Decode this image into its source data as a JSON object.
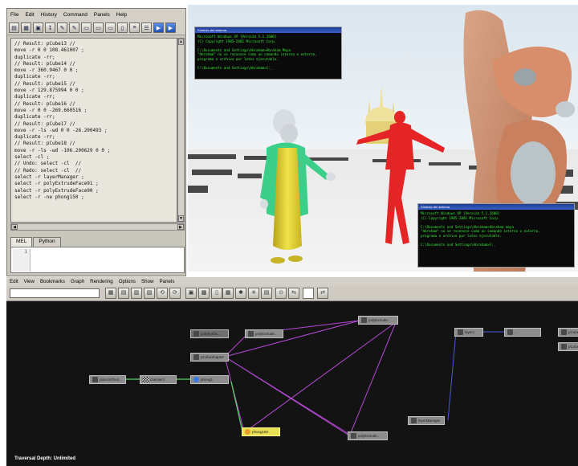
{
  "script_editor": {
    "menu": [
      "File",
      "Edit",
      "History",
      "Command",
      "Panels",
      "Help"
    ],
    "history_lines": [
      "// Result: pCube13 //",
      "move -r 0 0 108.461007 ;",
      "duplicate -rr;",
      "// Result: pCube14 //",
      "move -r 360.9467 0 0 ;",
      "duplicate -rr;",
      "// Result: pCube15 //",
      "move -r 129.875994 0 0 ;",
      "duplicate -rr;",
      "// Result: pCube16 //",
      "move -r 0 0 -269.660516 ;",
      "duplicate -rr;",
      "// Result: pCube17 //",
      "move -r -ls -wd 0 0 -26.200493 ;",
      "duplicate -rr;",
      "// Result: pCube18 //",
      "move -r -ls -wd -106.200629 0 0 ;",
      "select -cl ;",
      "// Undo: select -cl  //",
      "// Redo: select -cl  //",
      "select -r layerManager ;",
      "select -r polyExtrudeFace91 ;",
      "select -r polyExtrudeFace90 ;",
      "select -r -ne phong150 ;"
    ],
    "tabs": [
      "MEL",
      "Python"
    ],
    "line_number": "1"
  },
  "viewport": {
    "terminal_top": {
      "title": "Símbolo del sistema",
      "lines": [
        "Microsoft Windows XP [Versión 5.1.2600]",
        "(C) Copyright 1985-2001 Microsoft Corp.",
        "",
        "C:\\Documents and Settings\\Abraham>Abraham Maya",
        "\"Abraham\" no se reconoce como un comando interno o externo,",
        "programa o archivo por lotes ejecutable.",
        "",
        "C:\\Documents and Settings\\Abraham>C:_"
      ]
    },
    "terminal_bottom": {
      "title": "Símbolo del sistema",
      "lines": [
        "Microsoft Windows XP [Versión 5.1.2600]",
        "(C) Copyright 1985-2001 Microsoft Corp.",
        "",
        "C:\\Documents and Settings\\Abraham>Abraham maya",
        "\"Abraham\" no se reconoce como un comando interno o externo,",
        "programa o archivo por lotes ejecutable.",
        "",
        "C:\\Documents and Settings\\Abraham>C:_"
      ]
    }
  },
  "node_editor": {
    "menu": [
      "Edit",
      "View",
      "Bookmarks",
      "Graph",
      "Rendering",
      "Options",
      "Show",
      "Panels"
    ],
    "nodes": [
      {
        "id": "n_place",
        "label": "place2dText..."
      },
      {
        "id": "n_checker",
        "label": "checker1"
      },
      {
        "id": "n_phong1",
        "label": "phong1"
      },
      {
        "id": "n_phong150",
        "label": "phong150"
      },
      {
        "id": "n_pcubeshape",
        "label": "pCubeShape2"
      },
      {
        "id": "n_polysurf",
        "label": "polySurfac..."
      },
      {
        "id": "n_polyext1",
        "label": "polyExtrude..."
      },
      {
        "id": "n_polyext2",
        "label": "polyExtrude..."
      },
      {
        "id": "n_polyext3",
        "label": "polyExtrude..."
      },
      {
        "id": "n_layer1",
        "label": "layer1"
      },
      {
        "id": "n_layer1b",
        "label": "..."
      },
      {
        "id": "n_layermanager",
        "label": "layerManager"
      },
      {
        "id": "n_pcube_a",
        "label": "pCube"
      },
      {
        "id": "n_pcube_b",
        "label": "pCube"
      }
    ],
    "traversal_depth": "Traversal Depth: Unlimited"
  },
  "colors": {
    "graph_bg": "#131313",
    "connection_purple": "#b54ad6",
    "connection_green": "#5ed36a",
    "connection_blue": "#4a5ad8",
    "node_gray": "#8c8c8c",
    "node_selected": "#e8e054",
    "terminal_text": "#37e637"
  }
}
